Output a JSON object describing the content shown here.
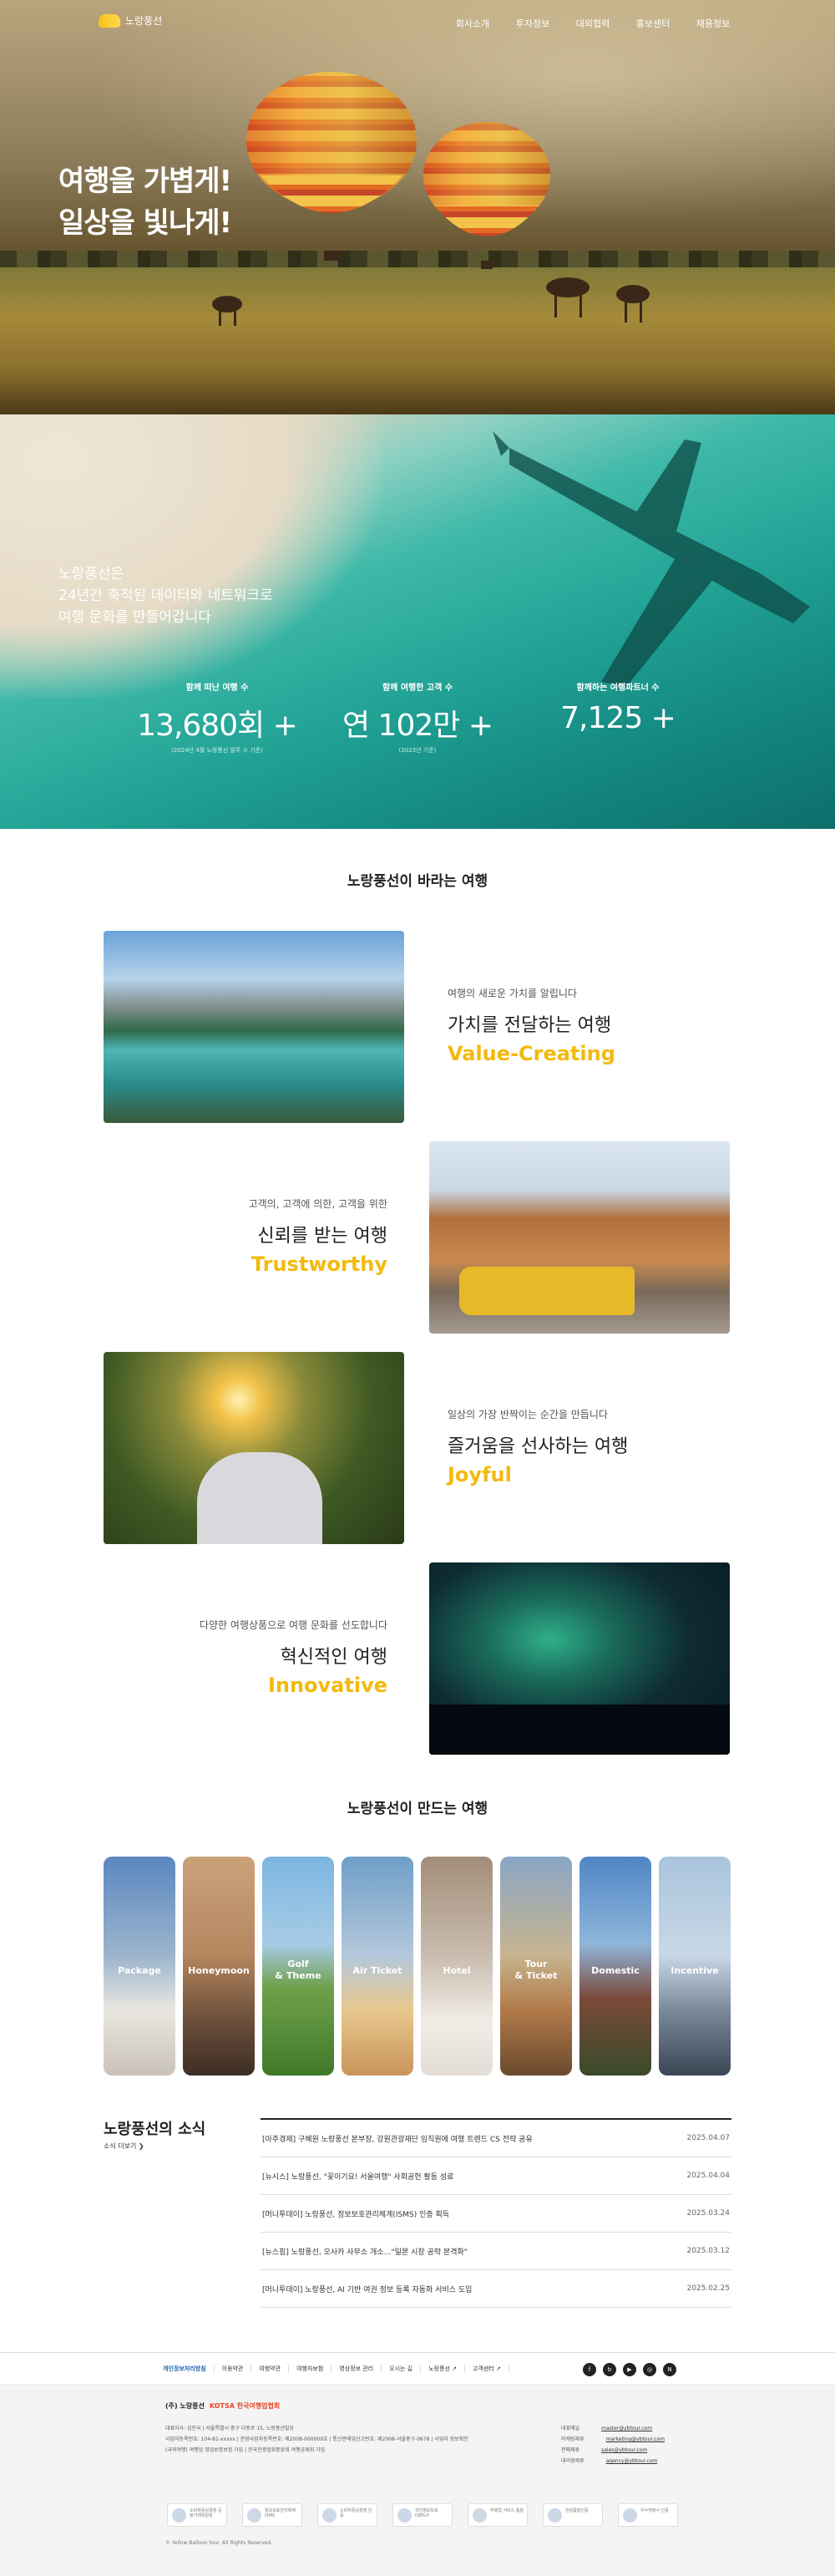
{
  "header": {
    "logo_text": "노랑풍선",
    "menu": [
      "회사소개",
      "투자정보",
      "대외협력",
      "홍보센터",
      "채용정보"
    ]
  },
  "hero": {
    "line1": "여행을 가볍게!",
    "line2": "일상을 빛나게!"
  },
  "stats": {
    "intro": [
      "노랑풍선은",
      "24년간 축적된 데이터와 네트워크로",
      "여행 문화를 만들어갑니다"
    ],
    "items": [
      {
        "label": "함께 떠난 여행 수",
        "value": "13,680회 +",
        "sub": "(2024년 4월 노랑풍선 발주 수 기준)"
      },
      {
        "label": "함께 여행한 고객 수",
        "value": "연 102만 +",
        "sub": "(2023년 기준)"
      },
      {
        "label": "함께하는 여행파트너 수",
        "value": "7,125 +",
        "sub": ""
      }
    ]
  },
  "values": {
    "title": "노랑풍선이 바라는 여행",
    "items": [
      {
        "sub": "여행의 새로운 가치를 알립니다",
        "ko": "가치를 전달하는 여행",
        "en": "Value-Creating"
      },
      {
        "sub": "고객의, 고객에 의한, 고객을 위한",
        "ko": "신뢰를 받는 여행",
        "en": "Trustworthy"
      },
      {
        "sub": "일상의 가장 반짝이는 순간을 만듭니다",
        "ko": "즐거움을 선사하는 여행",
        "en": "Joyful"
      },
      {
        "sub": "다양한 여행상품으로 여행 문화를 선도합니다",
        "ko": "혁신적인 여행",
        "en": "Innovative"
      }
    ]
  },
  "products": {
    "title": "노랑풍선이 만드는 여행",
    "items": [
      "Package",
      "Honeymoon",
      "Golf\n& Theme",
      "Air Ticket",
      "Hotel",
      "Tour\n& Ticket",
      "Domestic",
      "Incentive"
    ]
  },
  "news": {
    "title": "노랑풍선의 소식",
    "more": "소식 더보기",
    "items": [
      {
        "t": "[아주경제] 구혜원 노랑풍선 본부장, 강원관광재단 임직원에 여행 트렌드 CS 전략 공유",
        "d": "2025.04.07"
      },
      {
        "t": "[뉴시스] 노랑풍선, \"꽃이기요! 서울여행\" 사회공헌 활동 성료",
        "d": "2025.04.04"
      },
      {
        "t": "[머니투데이] 노랑풍선, 정보보호관리체계(ISMS) 인증 획득",
        "d": "2025.03.24"
      },
      {
        "t": "[뉴스핌] 노랑풍선, 오사카 사무소 개소…\"일본 시장 공략 본격화\"",
        "d": "2025.03.12"
      },
      {
        "t": "[머니투데이] 노랑풍선, AI 기반 여권 정보 등록 자동화 서비스 도입",
        "d": "2025.02.25"
      }
    ]
  },
  "footer": {
    "links": [
      "개인정보처리방침",
      "이용약관",
      "여행약관",
      "여행자보험",
      "영상정보 관리",
      "오시는 길",
      "노랑풍선 ↗",
      "고객센터 ↗"
    ],
    "social": [
      "f",
      "b",
      "▶",
      "◎",
      "N"
    ],
    "brand": "(주) 노랑풍선",
    "brand2": "KOTSA 한국여행업협회",
    "info": [
      "대표이사: 김진국 | 서울특별시 중구 다동로 15, 노랑풍선빌딩",
      "사업자등록번호: 104-81-xxxxx | 관광사업자등록번호: 제2008-000009호 | 통신판매업신고번호: 제2008-서울중구-0678 | 사업자 정보확인",
      "(국외여행) 여행업 영업보증보험 가입 | 한국관광협회중앙회 여행공제회 가입"
    ],
    "contacts": [
      {
        "k": "대표메일",
        "v": "master@ybtour.com"
      },
      {
        "k": "마케팅제휴",
        "v": "marketing@ybtour.com"
      },
      {
        "k": "판매제휴",
        "v": "sales@ybtour.com"
      },
      {
        "k": "대리점제휴",
        "v": "agency@ybtour.com"
      }
    ],
    "certs": [
      "소비자중심경영 공정거래위원회",
      "정보보호관리체계 ISMS",
      "소비자중심경영 인증",
      "개인정보보호 ISMS-P",
      "여행업 서비스 품질",
      "관광품질인증",
      "우수여행사 인증"
    ],
    "copy": "© Yellow Balloon tour. All Rights Reserved."
  }
}
